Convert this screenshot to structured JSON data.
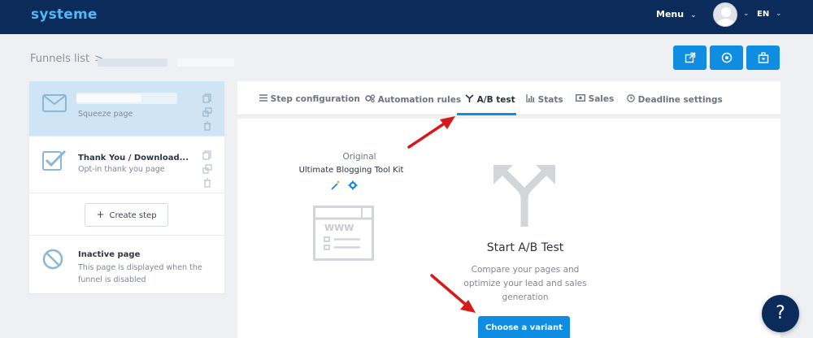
{
  "topbar": {
    "logo": "systeme",
    "menu_label": "Menu",
    "lang_label": "EN"
  },
  "breadcrumb": {
    "label": "Funnels list",
    "separator": ">"
  },
  "steps": [
    {
      "title": "",
      "subtitle": "Squeeze page",
      "icon": "mail-icon",
      "active": true
    },
    {
      "title": "Thank You / Download...",
      "subtitle": "Opt-in thank you page",
      "icon": "checkbox-icon",
      "active": false
    }
  ],
  "create_step_label": "Create step",
  "inactive_page": {
    "title": "Inactive page",
    "description": "This page is displayed when the funnel is disabled"
  },
  "tabs": [
    {
      "label": "Step configuration",
      "icon": "list-icon"
    },
    {
      "label": "Automation rules",
      "icon": "gears-icon"
    },
    {
      "label": "A/B test",
      "icon": "split-icon",
      "active": true
    },
    {
      "label": "Stats",
      "icon": "bar-chart-icon"
    },
    {
      "label": "Sales",
      "icon": "money-icon"
    },
    {
      "label": "Deadline settings",
      "icon": "clock-icon"
    }
  ],
  "original": {
    "label": "Original",
    "name": "Ultimate Blogging Tool Kit"
  },
  "web_icon_text": "WWW",
  "ab_test": {
    "title": "Start A/B Test",
    "description": "Compare your pages and optimize your lead and sales generation",
    "button": "Choose a variant"
  },
  "help_label": "?",
  "colors": {
    "topbar": "#0b2c5a",
    "accent": "#0f8de3",
    "active_step": "#cfe5f5",
    "arrow": "#d7191c"
  }
}
